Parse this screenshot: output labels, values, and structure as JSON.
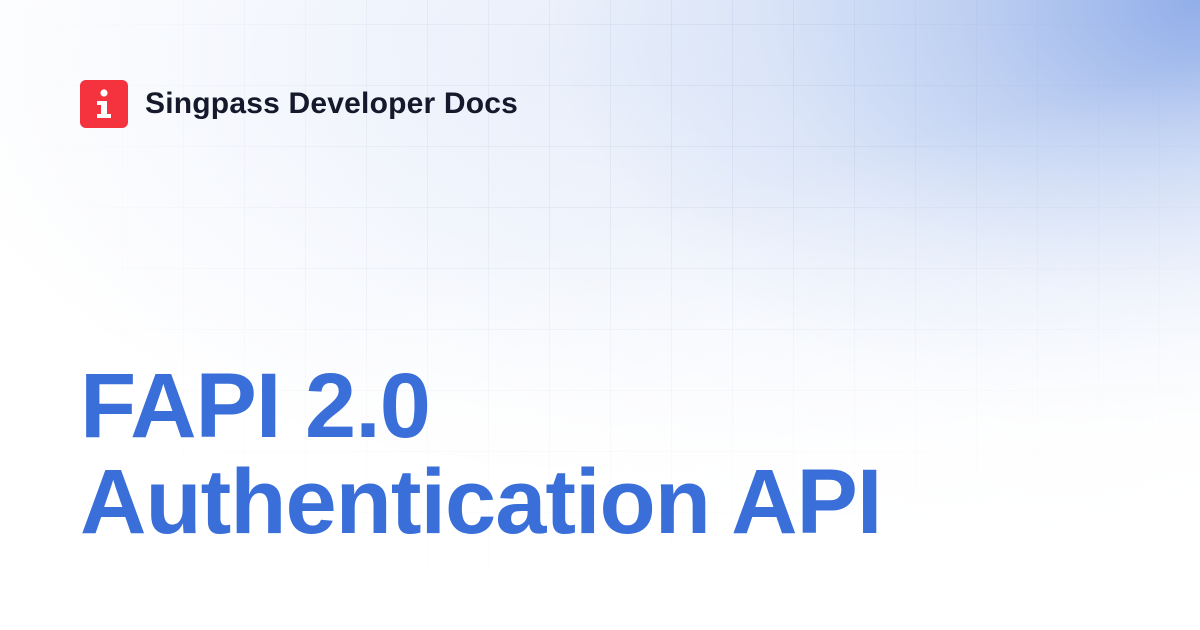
{
  "brand": {
    "logo_icon": "singpass-info-logo-icon",
    "logo_color": "#f5333f",
    "name": "Singpass Developer Docs"
  },
  "hero": {
    "title_line_1": "FAPI 2.0",
    "title_line_2": "Authentication API",
    "title_color": "#3a6fd9"
  },
  "background": {
    "style": "grid-with-blue-gradient",
    "accent_color": "#9cb6ee"
  }
}
